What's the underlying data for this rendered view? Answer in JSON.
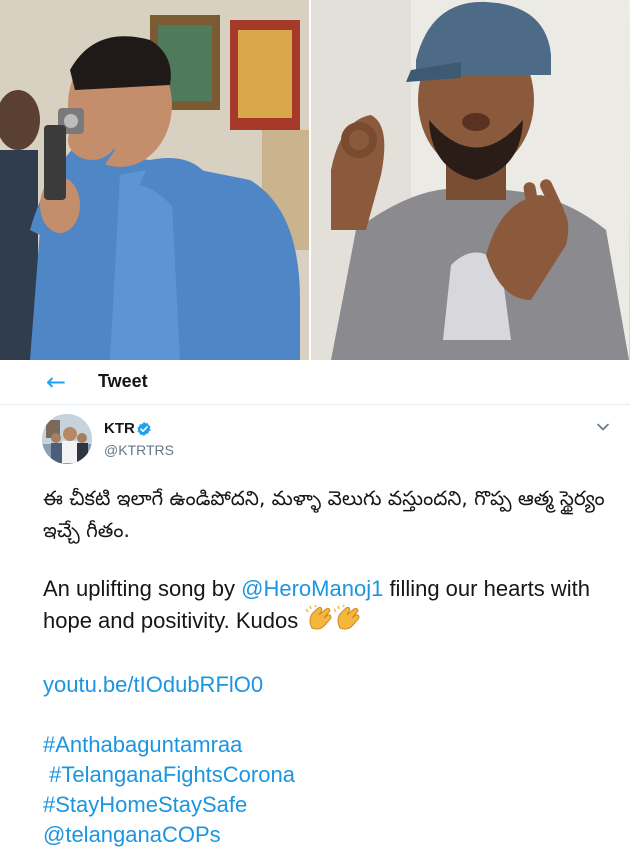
{
  "header": {
    "back_icon": "arrow-left-icon",
    "title": "Tweet"
  },
  "author": {
    "name": "KTR",
    "handle": "@KTRTRS",
    "verified": true,
    "verified_icon": "verified-badge-icon"
  },
  "tweet": {
    "telugu_text": "ఈ చీకటి ఇలాగే ఉండిపోదని, మళ్ళా వెలుగు వస్తుందని, గొప్ప ఆత్మ స్థైర్యం ఇచ్చే గీతం.",
    "english_prefix": "An uplifting song by ",
    "mention": "@HeroManoj1",
    "english_suffix": " filling our hearts with hope and positivity. Kudos",
    "emoji_icon": "clapping-hands-icon",
    "link": "youtu.be/tIOdubRFlO0",
    "hashtags": [
      "#Anthabaguntamraa",
      " #TelanganaFightsCorona",
      "#StayHomeStaySafe"
    ],
    "last_mention": "@telanganaCOPs"
  },
  "colors": {
    "link": "#1b95e0",
    "accent": "#1da1f2",
    "secondary_text": "#657786",
    "divider": "#e6ecf0"
  }
}
